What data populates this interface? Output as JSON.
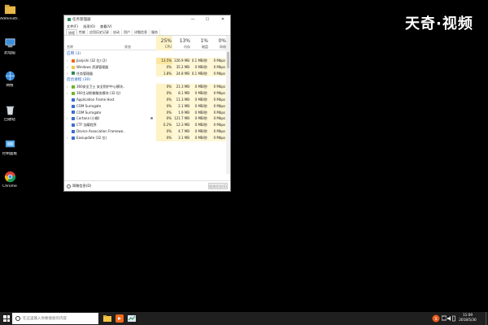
{
  "watermark": "天奇·视频",
  "desktop": {
    "icons": [
      {
        "name": "user-folder",
        "label": "Administr..."
      },
      {
        "name": "this-pc",
        "label": "此电脑"
      },
      {
        "name": "network",
        "label": "网络"
      },
      {
        "name": "recycle-bin",
        "label": "回收站"
      },
      {
        "name": "control-panel",
        "label": "控制面板"
      },
      {
        "name": "chrome",
        "label": "Chrome"
      }
    ]
  },
  "task_manager": {
    "title": "任务管理器",
    "controls": {
      "minimize": "—",
      "maximize": "☐",
      "close": "✕"
    },
    "menu": [
      "文件(F)",
      "选项(O)",
      "查看(V)"
    ],
    "tabs": [
      "进程",
      "性能",
      "应用历史记录",
      "启动",
      "用户",
      "详细信息",
      "服务"
    ],
    "header": {
      "name": "名称",
      "status": "状态",
      "cpu": {
        "pct": "25%",
        "label": "CPU"
      },
      "memory": {
        "pct": "13%",
        "label": "内存"
      },
      "disk": {
        "pct": "1%",
        "label": "磁盘"
      },
      "network": {
        "pct": "0%",
        "label": "网络"
      }
    },
    "groups": {
      "apps": {
        "label": "应用 (3)",
        "rows": [
          {
            "name": "Jianjishi (32 位) (2)",
            "cpu": "13.5%",
            "mem": "226.9 MB",
            "disk": "0.1 MB/秒",
            "net": "0 Mbps",
            "icon_color": "#f06a1c",
            "expandable": true
          },
          {
            "name": "Windows 资源管理器",
            "cpu": "0%",
            "mem": "35.2 MB",
            "disk": "0 MB/秒",
            "net": "0 Mbps",
            "icon_color": "#f4c542",
            "expandable": true
          },
          {
            "name": "任务管理器",
            "cpu": "1.8%",
            "mem": "24.8 MB",
            "disk": "0.1 MB/秒",
            "net": "0 Mbps",
            "icon_color": "#2e8b57",
            "expandable": true
          }
        ]
      },
      "background": {
        "label": "后台进程 (30)",
        "rows": [
          {
            "name": "360安全卫士 安全防护中心模块...",
            "cpu": "0%",
            "mem": "21.3 MB",
            "disk": "0 MB/秒",
            "net": "0 Mbps",
            "icon_color": "#6fb62c",
            "expandable": true
          },
          {
            "name": "360主动防御服务模块 (32 位)",
            "cpu": "0%",
            "mem": "8.1 MB",
            "disk": "0 MB/秒",
            "net": "0 Mbps",
            "icon_color": "#6fb62c",
            "expandable": true
          },
          {
            "name": "Application Frame Host",
            "cpu": "0%",
            "mem": "11.3 MB",
            "disk": "0 MB/秒",
            "net": "0 Mbps",
            "icon_color": "#3a6fd0",
            "expandable": false
          },
          {
            "name": "COM Surrogate",
            "cpu": "0%",
            "mem": "2.1 MB",
            "disk": "0 MB/秒",
            "net": "0 Mbps",
            "icon_color": "#3a6fd0",
            "expandable": false
          },
          {
            "name": "COM Surrogate",
            "cpu": "0%",
            "mem": "1.9 MB",
            "disk": "0 MB/秒",
            "net": "0 Mbps",
            "icon_color": "#3a6fd0",
            "expandable": false
          },
          {
            "name": "Cortana (小娜)",
            "cpu": "0%",
            "mem": "121.7 MB",
            "disk": "0 MB/秒",
            "net": "0 Mbps",
            "icon_color": "#3a6fd0",
            "expandable": true,
            "leaf": true
          },
          {
            "name": "CTF 加载程序",
            "cpu": "0.2%",
            "mem": "12.3 MB",
            "disk": "0 MB/秒",
            "net": "0 Mbps",
            "icon_color": "#3a6fd0",
            "expandable": false
          },
          {
            "name": "Device Association Framewo...",
            "cpu": "0%",
            "mem": "4.7 MB",
            "disk": "0 MB/秒",
            "net": "0 Mbps",
            "icon_color": "#3a6fd0",
            "expandable": false
          },
          {
            "name": "Easiupdate (32 位)",
            "cpu": "0%",
            "mem": "3.1 MB",
            "disk": "0 MB/秒",
            "net": "0 Mbps",
            "icon_color": "#3a6fd0",
            "expandable": true
          }
        ]
      }
    },
    "footer": {
      "fewer_details": "简略信息(D)",
      "end_task": "结束任务(E)"
    }
  },
  "taskbar": {
    "search_placeholder": "在这里输入你要搜索的内容",
    "clock": {
      "time": "11:09",
      "date": "2018/5/30"
    }
  },
  "colors": {
    "cpu_highlight": "#fdf3c6",
    "group_label": "#1f5fb8",
    "desktop": "#000000",
    "taskbar": "#1f1f1f"
  }
}
